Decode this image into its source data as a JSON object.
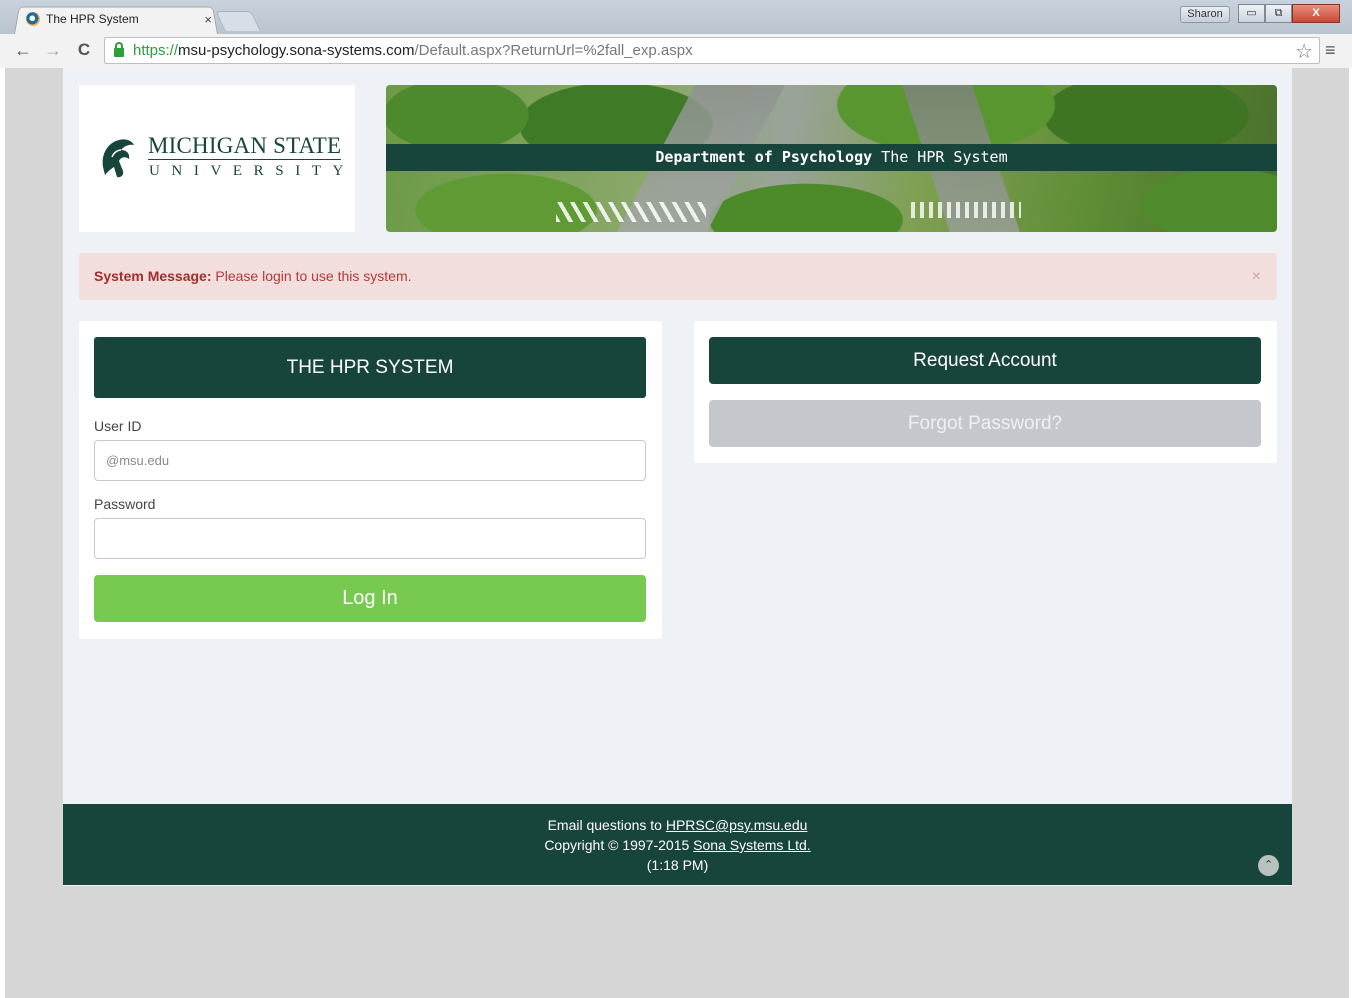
{
  "browser": {
    "tab_title": "The HPR System",
    "tab_close": "×",
    "profile_name": "Sharon",
    "window_controls": {
      "minimize": "▭",
      "maximize": "⧉",
      "close": "X"
    },
    "nav": {
      "back": "←",
      "forward": "→",
      "reload": "C"
    },
    "url_scheme": "https://",
    "url_host": "msu-psychology.sona-systems.com",
    "url_path": "/Default.aspx?ReturnUrl=%2fall_exp.aspx",
    "icons": [
      "lock-icon",
      "star-icon",
      "menu-icon"
    ]
  },
  "header": {
    "logo_line1": "MICHIGAN STATE",
    "logo_line2": "UNIVERSITY",
    "banner_strong": "Department of Psychology",
    "banner_rest": "The HPR System"
  },
  "alert": {
    "label": "System Message:",
    "text": "Please login to use this system.",
    "close": "×"
  },
  "login": {
    "title": "THE HPR SYSTEM",
    "userid_label": "User ID",
    "userid_placeholder": "@msu.edu",
    "userid_value": "",
    "password_label": "Password",
    "password_value": "",
    "submit_label": "Log In"
  },
  "account": {
    "request_label": "Request Account",
    "forgot_label": "Forgot Password?"
  },
  "footer": {
    "email_prefix": "Email questions to",
    "email": "HPRSC@psy.msu.edu",
    "copyright_prefix": "Copyright © 1997-2015",
    "company": "Sona Systems Ltd.",
    "time": "(1:18 PM)",
    "scroll_top": "⌃"
  },
  "colors": {
    "msu_green": "#18453b",
    "login_green": "#78c94f",
    "alert_bg": "#f3dede",
    "alert_text": "#a32d2a",
    "page_bg": "#eef1f5"
  }
}
